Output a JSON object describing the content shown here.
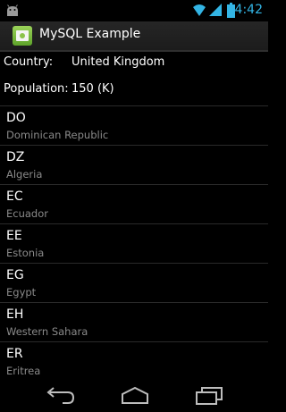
{
  "status_bar": {
    "time": "4:42",
    "icons": [
      "android-icon",
      "wifi-icon",
      "signal-icon",
      "battery-icon"
    ],
    "accent_color": "#33b5e5"
  },
  "action_bar": {
    "title": "MySQL Example",
    "icon": "app-icon"
  },
  "info": {
    "country_label": "Country:",
    "country_value": "United Kingdom",
    "population_label": "Population:",
    "population_value": "150 (K)"
  },
  "countries": [
    {
      "code": "DO",
      "name": "Dominican Republic"
    },
    {
      "code": "DZ",
      "name": "Algeria"
    },
    {
      "code": "EC",
      "name": "Ecuador"
    },
    {
      "code": "EE",
      "name": "Estonia"
    },
    {
      "code": "EG",
      "name": "Egypt"
    },
    {
      "code": "EH",
      "name": "Western Sahara"
    },
    {
      "code": "ER",
      "name": "Eritrea"
    }
  ],
  "nav_bar": {
    "buttons": [
      "back-icon",
      "home-icon",
      "recent-apps-icon"
    ]
  }
}
